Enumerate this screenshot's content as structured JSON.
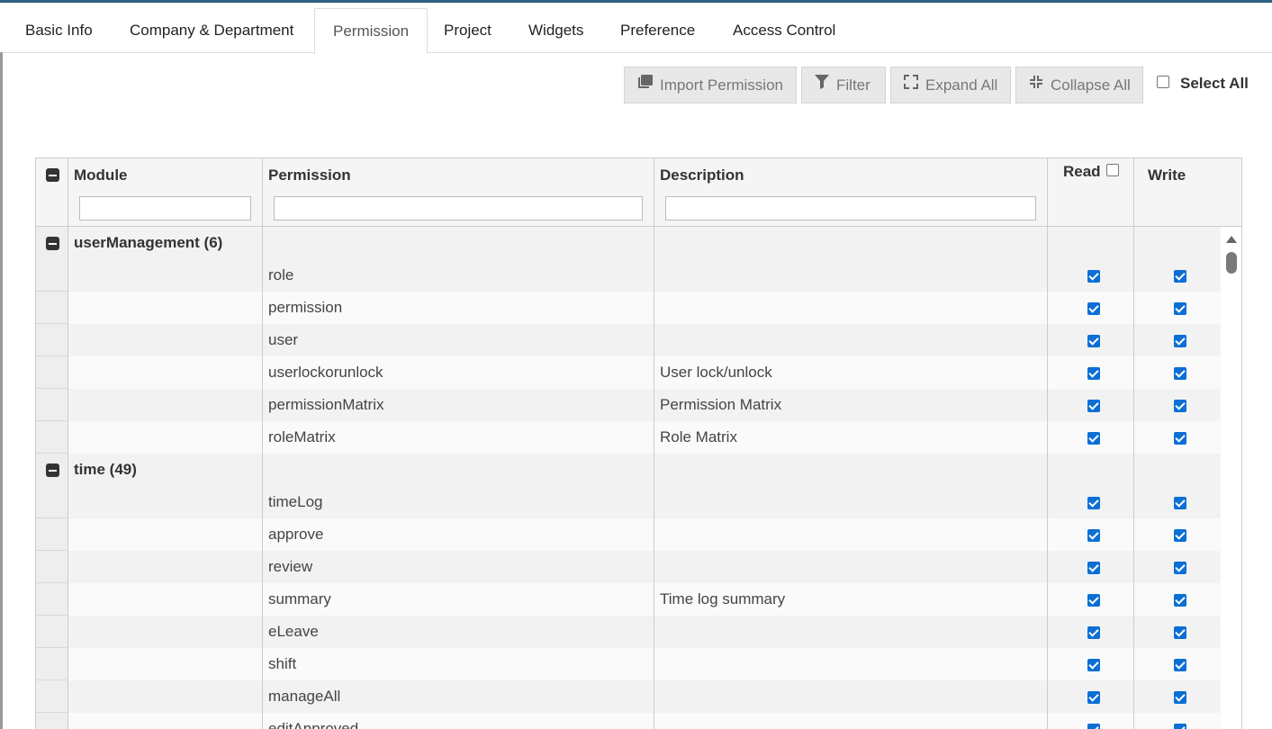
{
  "tabs": [
    {
      "label": "Basic Info"
    },
    {
      "label": "Company & Department"
    },
    {
      "label": "Permission"
    },
    {
      "label": "Project"
    },
    {
      "label": "Widgets"
    },
    {
      "label": "Preference"
    },
    {
      "label": "Access Control"
    }
  ],
  "active_tab": "Permission",
  "toolbar": {
    "import_label": "Import Permission",
    "filter_label": "Filter",
    "expand_label": "Expand All",
    "collapse_label": "Collapse All",
    "select_all_label": "Select All",
    "select_all_checked": false
  },
  "grid": {
    "columns": {
      "module": "Module",
      "permission": "Permission",
      "description": "Description",
      "read": "Read",
      "write": "Write"
    },
    "rows": [
      {
        "group": "userManagement (6)"
      },
      {
        "permission": "role",
        "description": "",
        "read": true,
        "write": true
      },
      {
        "permission": "permission",
        "description": "",
        "read": true,
        "write": true
      },
      {
        "permission": "user",
        "description": "",
        "read": true,
        "write": true
      },
      {
        "permission": "userlockorunlock",
        "description": "User lock/unlock",
        "read": true,
        "write": true
      },
      {
        "permission": "permissionMatrix",
        "description": "Permission Matrix",
        "read": true,
        "write": true
      },
      {
        "permission": "roleMatrix",
        "description": "Role Matrix",
        "read": true,
        "write": true
      },
      {
        "group": "time (49)"
      },
      {
        "permission": "timeLog",
        "description": "",
        "read": true,
        "write": true
      },
      {
        "permission": "approve",
        "description": "",
        "read": true,
        "write": true
      },
      {
        "permission": "review",
        "description": "",
        "read": true,
        "write": true
      },
      {
        "permission": "summary",
        "description": "Time log summary",
        "read": true,
        "write": true
      },
      {
        "permission": "eLeave",
        "description": "",
        "read": true,
        "write": true
      },
      {
        "permission": "shift",
        "description": "",
        "read": true,
        "write": true
      },
      {
        "permission": "manageAll",
        "description": "",
        "read": true,
        "write": true
      },
      {
        "permission": "editApproved",
        "description": "",
        "read": true,
        "write": true
      }
    ]
  },
  "colors": {
    "checkbox": "#0b6fd6",
    "header_bg": "#f5f5f5",
    "accent": "#2d5f7f"
  }
}
